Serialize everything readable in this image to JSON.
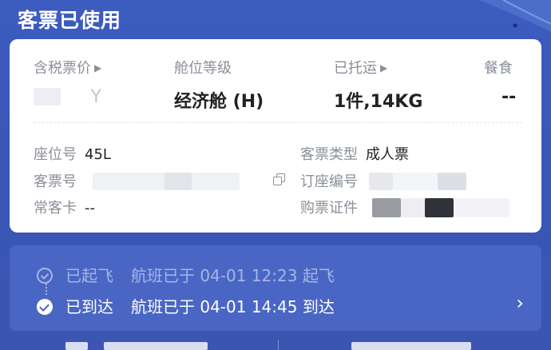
{
  "header": {
    "title": "客票已使用"
  },
  "ticket_card": {
    "columns": [
      {
        "label": "含税票价",
        "has_arrow": true,
        "value": "Y"
      },
      {
        "label": "舱位等级",
        "has_arrow": false,
        "value": "经济舱 (H)"
      },
      {
        "label": "已托运",
        "has_arrow": true,
        "value": "1件,14KG"
      },
      {
        "label": "餐食",
        "has_arrow": false,
        "value": "--"
      }
    ],
    "seat": {
      "label": "座位号",
      "value": "45L"
    },
    "passenger_type": {
      "label": "客票类型",
      "value": "成人票"
    },
    "ticket_number": {
      "label": "客票号",
      "value": ""
    },
    "booking_code": {
      "label": "订座编号",
      "value": ""
    },
    "frequent_flyer": {
      "label": "常客卡",
      "value": "--"
    },
    "id_document": {
      "label": "购票证件",
      "value": ""
    }
  },
  "flight_status": {
    "departed": {
      "label": "已起飞",
      "detail": "航班已于 04-01 12:23 起飞"
    },
    "arrived": {
      "label": "已到达",
      "detail": "航班已于 04-01 14:45 到达"
    }
  },
  "colors": {
    "background": "#3b58b8",
    "card": "#ffffff",
    "status_panel": "#4a66c4",
    "muted_text": "#8a8f9a",
    "primary_text": "#222222"
  }
}
